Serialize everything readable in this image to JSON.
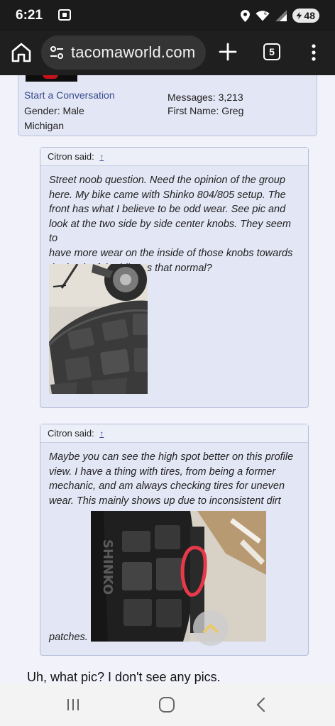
{
  "status_bar": {
    "time": "6:21",
    "battery": "48",
    "icons": [
      "screen-record-icon",
      "location-icon",
      "wifi-icon",
      "signal-icon",
      "battery-icon"
    ]
  },
  "browser": {
    "url": "tacomaworld.com",
    "tab_count": "5",
    "icons": [
      "home-icon",
      "site-settings-icon",
      "new-tab-icon",
      "tab-switcher-icon",
      "menu-icon"
    ]
  },
  "profile": {
    "start_conversation": "Start a Conversation",
    "gender": "Gender:  Male",
    "location": "Michigan",
    "messages": "Messages:  3,213",
    "first_name": "First Name:  Greg"
  },
  "quotes": [
    {
      "author_said": "Citron said:",
      "jump": "↑",
      "lines": [
        "Street noob question. Need the opinion of the group",
        "here. My bike came with Shinko 804/805 setup. The",
        "front has what I believe to be odd wear. See pic and",
        "look at the two side by side center knobs. They seem to",
        "have more wear on the inside of those knobs towards",
        "the back of the bike. Is that normal?"
      ]
    },
    {
      "author_said": "Citron said:",
      "jump": "↑",
      "lines": [
        "Maybe you can see the high spot better on this profile",
        "view. I have a thing with tires, from being a former",
        "mechanic, and am always checking tires for uneven",
        "wear. This mainly shows up due to inconsistent dirt"
      ],
      "trailing": "patches."
    }
  ],
  "reply_text": "Uh, what pic? I don't see any pics.",
  "colors": {
    "page_bg": "#f2f3fa",
    "quote_bg": "#e3e6f4",
    "quote_border": "#b3bcd8",
    "link": "#3a4c8f",
    "annotation_circle": "#e8394a"
  },
  "nav_bar": {
    "icons": [
      "recent-apps-icon",
      "home-circle-icon",
      "back-icon"
    ]
  }
}
